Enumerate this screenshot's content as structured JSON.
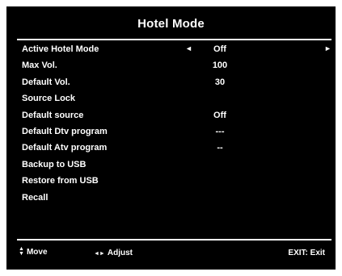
{
  "title": "Hotel Mode",
  "items": [
    {
      "label": "Active Hotel Mode",
      "value": "Off",
      "left_arrow": "◄",
      "right_arrow": "►"
    },
    {
      "label": "Max Vol.",
      "value": "100"
    },
    {
      "label": "Default Vol.",
      "value": "30"
    },
    {
      "label": "Source Lock",
      "value": ""
    },
    {
      "label": "Default source",
      "value": "Off"
    },
    {
      "label": "Default Dtv program",
      "value": "---"
    },
    {
      "label": "Default Atv program",
      "value": "--"
    },
    {
      "label": "Backup to USB",
      "value": ""
    },
    {
      "label": "Restore from USB",
      "value": ""
    },
    {
      "label": "Recall",
      "value": ""
    }
  ],
  "footer": {
    "move_up_icon": "▲",
    "move_down_icon": "▼",
    "move_label": "Move",
    "adjust_icon": "◄►",
    "adjust_label": "Adjust",
    "exit_label": "EXIT: Exit"
  },
  "colors": {
    "background": "#000000",
    "text": "#ffffff",
    "frame": "#ffffff"
  }
}
